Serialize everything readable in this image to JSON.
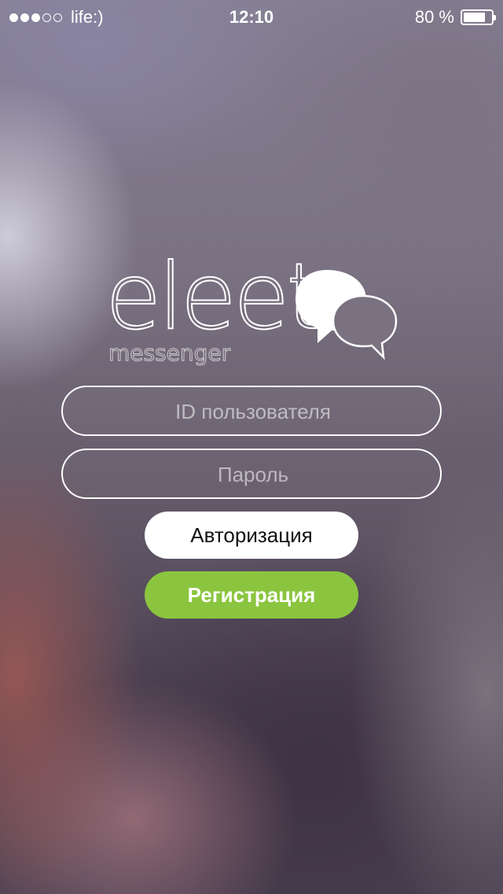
{
  "status_bar": {
    "carrier": "life:)",
    "time": "12:10",
    "battery_percent": "80 %",
    "signal_bars_filled": 3,
    "signal_bars_total": 5,
    "battery_level": 0.8
  },
  "logo": {
    "wordmark": "eleet",
    "subtitle": "messenger",
    "icon": "chat-bubbles-icon"
  },
  "login_form": {
    "user_id_placeholder": "ID пользователя",
    "user_id_value": "",
    "password_placeholder": "Пароль",
    "password_value": "",
    "login_button_label": "Авторизация",
    "register_button_label": "Регистрация"
  },
  "colors": {
    "register_button": "#8bc53f",
    "login_button": "#ffffff"
  }
}
